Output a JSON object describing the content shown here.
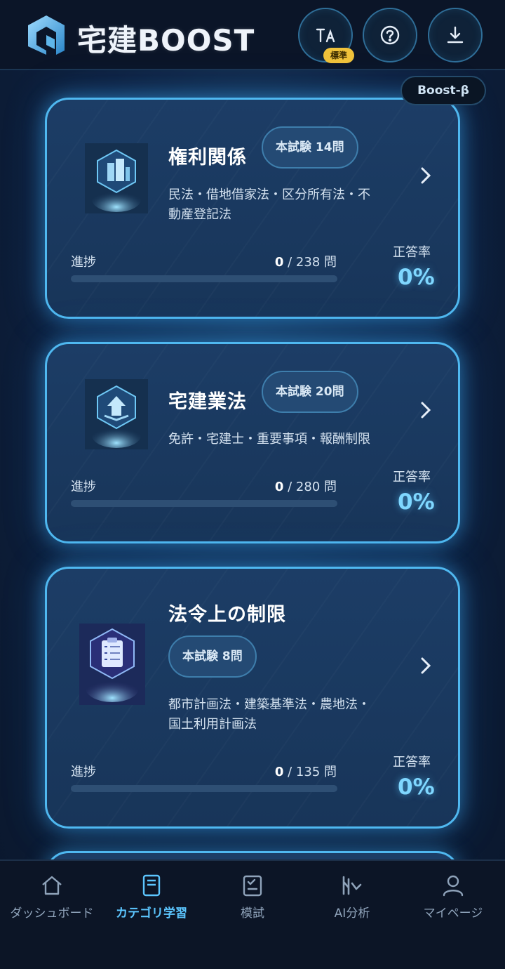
{
  "app": {
    "title": "宅建BOOST",
    "beta_label": "Boost-β"
  },
  "header": {
    "font_size_button": {
      "icon": "text-size-icon",
      "badge": "標準"
    },
    "help_button": {
      "icon": "help-icon"
    },
    "download_button": {
      "icon": "download-icon"
    }
  },
  "cards": [
    {
      "icon": "building-shield-icon",
      "title": "権利関係",
      "badge": "本試験 14問",
      "desc_line1": "民法・借地借家法・区分所有法・不",
      "desc_line2": "動産登記法",
      "progress_label": "進捗",
      "progress_done": "0",
      "progress_total": "/ 238 問",
      "progress_fraction": 0,
      "rate_label": "正答率",
      "rate_value": "0%"
    },
    {
      "icon": "book-shield-icon",
      "title": "宅建業法",
      "badge": "本試験 20問",
      "desc_line1": "免許・宅建士・重要事項・報酬制限",
      "desc_line2": "",
      "progress_label": "進捗",
      "progress_done": "0",
      "progress_total": "/ 280 問",
      "progress_fraction": 0,
      "rate_label": "正答率",
      "rate_value": "0%"
    },
    {
      "icon": "clipboard-checklist-icon",
      "title": "法令上の制限",
      "badge": "本試験 8問",
      "desc_line1": "都市計画法・建築基準法・農地法・",
      "desc_line2": "国土利用計画法",
      "progress_label": "進捗",
      "progress_done": "0",
      "progress_total": "/ 135 問",
      "progress_fraction": 0,
      "rate_label": "正答率",
      "rate_value": "0%"
    }
  ],
  "nav": [
    {
      "icon": "home-icon",
      "label": "ダッシュボード",
      "active": false
    },
    {
      "icon": "book-icon",
      "label": "カテゴリ学習",
      "active": true
    },
    {
      "icon": "exam-checklist-icon",
      "label": "模試",
      "active": false
    },
    {
      "icon": "analytics-icon",
      "label": "AI分析",
      "active": false
    },
    {
      "icon": "user-icon",
      "label": "マイページ",
      "active": false
    }
  ],
  "colors": {
    "accent": "#54c6ff",
    "card_border": "#4fb8f0",
    "badge_yellow": "#f0c23a",
    "background": "#0b1628"
  }
}
